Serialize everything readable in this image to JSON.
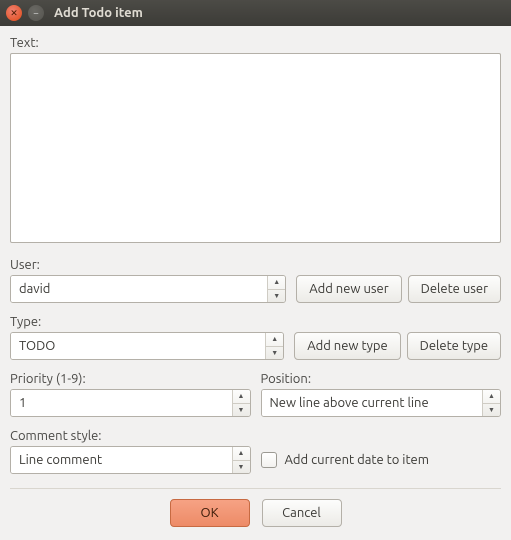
{
  "window": {
    "title": "Add Todo item"
  },
  "labels": {
    "text": "Text:",
    "user": "User:",
    "type": "Type:",
    "priority": "Priority (1-9):",
    "position": "Position:",
    "comment_style": "Comment style:"
  },
  "fields": {
    "text_value": "",
    "user_value": "david",
    "type_value": "TODO",
    "priority_value": "1",
    "position_value": "New line above current line",
    "comment_style_value": "Line comment",
    "add_date_checked": false
  },
  "buttons": {
    "add_user": "Add new user",
    "delete_user": "Delete user",
    "add_type": "Add new type",
    "delete_type": "Delete type",
    "ok": "OK",
    "cancel": "Cancel"
  },
  "checkbox": {
    "add_date_label": "Add current date to item"
  }
}
